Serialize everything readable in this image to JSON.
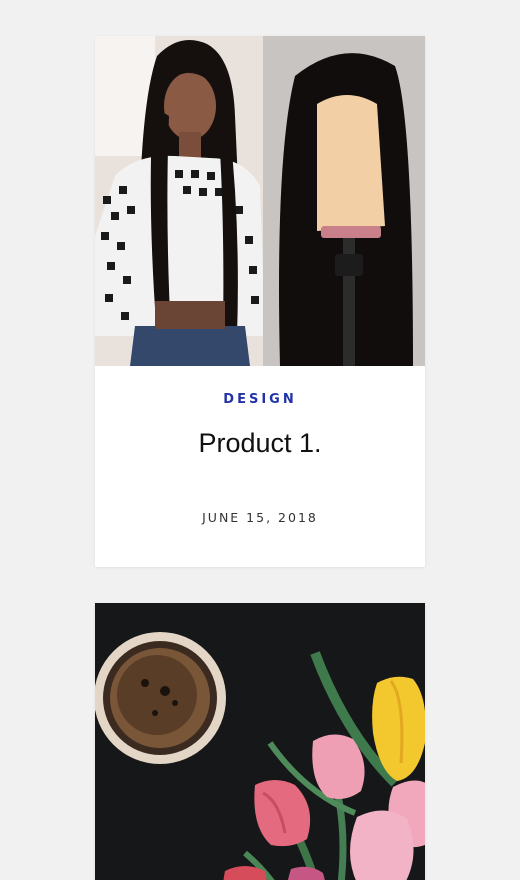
{
  "posts": [
    {
      "category": "DESIGN",
      "title": "Product 1.",
      "date": "JUNE 15, 2018",
      "image": "wig-product-photo"
    },
    {
      "image": "coffee-and-tulips-photo"
    }
  ],
  "colors": {
    "page_background": "#f1f1f1",
    "card_background": "#ffffff",
    "category_accent": "#2233a8",
    "title_text": "#111111",
    "date_text": "#333333"
  }
}
